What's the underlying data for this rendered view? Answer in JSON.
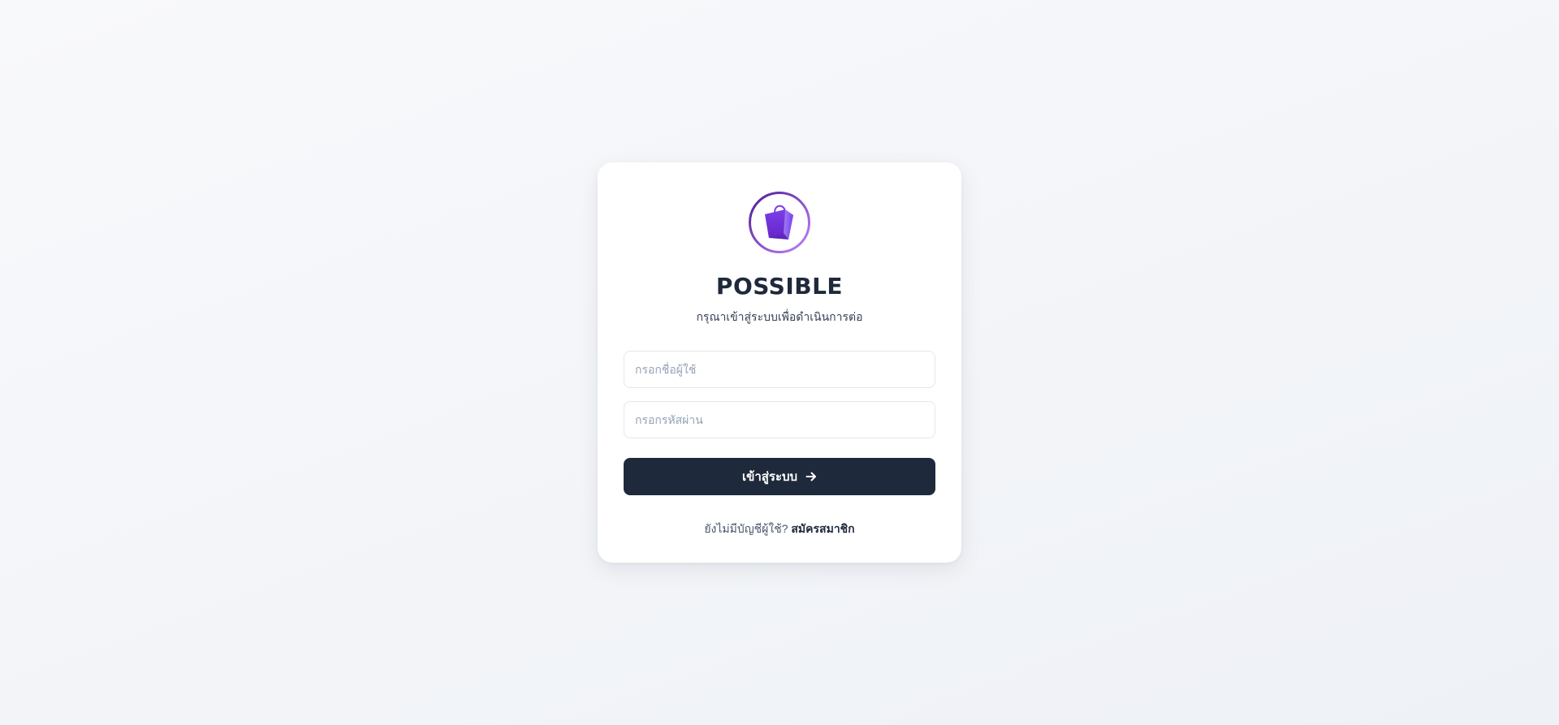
{
  "brand": {
    "name": "POSSIBLE",
    "logo_icon": "shopping-bag-icon",
    "logo_ring_gradient": [
      "#4c1d95",
      "#a855f7"
    ],
    "logo_bag_gradient": [
      "#6d28d9",
      "#a78bfa"
    ]
  },
  "login": {
    "subtitle": "กรุณาเข้าสู่ระบบเพื่อดำเนินการต่อ",
    "username": {
      "value": "",
      "placeholder": "กรอกชื่อผู้ใช้"
    },
    "password": {
      "value": "",
      "placeholder": "กรอกรหัสผ่าน"
    },
    "submit_label": "เข้าสู่ระบบ",
    "submit_icon": "arrow-right-icon",
    "no_account_text": "ยังไม่มีบัญชีผู้ใช้?",
    "register_label": "สมัครสมาชิก"
  },
  "colors": {
    "primary": "#1e293b",
    "accent": "#7c3aed",
    "background": "#f3f5f9"
  }
}
